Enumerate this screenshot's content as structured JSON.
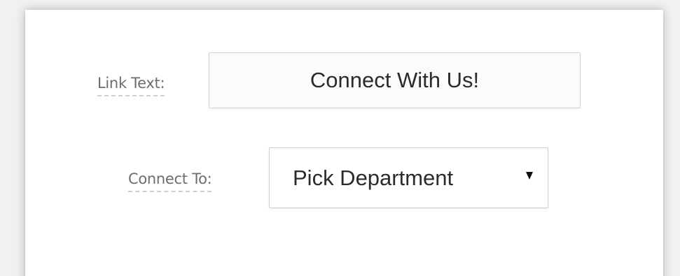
{
  "form": {
    "link_text_label": "Link Text:",
    "link_text_value": "Connect With Us!",
    "connect_to_label": "Connect To:",
    "connect_to_selected": "Pick Department",
    "dropdown_icon": "triangle-down-icon"
  },
  "colors": {
    "background": "#f1f1f1",
    "panel": "#ffffff",
    "label_text": "#6d6d6d",
    "field_text": "#2b2b2b",
    "field_border": "#d2d2d2"
  }
}
